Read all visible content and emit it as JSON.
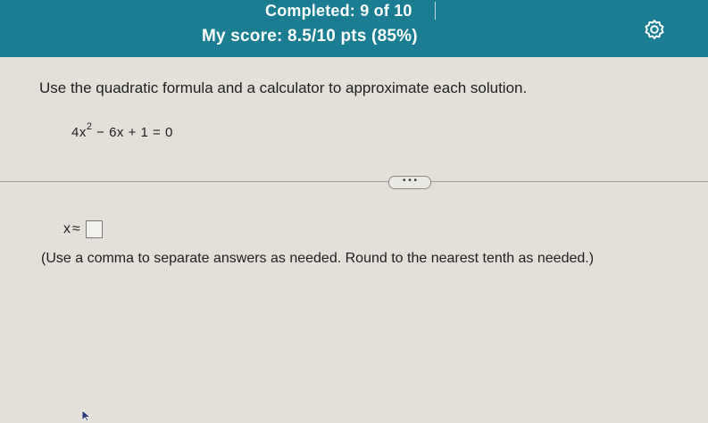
{
  "header": {
    "progress": "Completed: 9 of 10",
    "score": "My score: 8.5/10 pts (85%)",
    "settings_icon": "gear-icon"
  },
  "question": {
    "instructions": "Use the quadratic formula and a calculator to approximate each solution.",
    "equation": {
      "lead": "4x",
      "exponent": "2",
      "rest": "− 6x + 1 = 0"
    },
    "expand_label": "• • •",
    "answer": {
      "variable": "x",
      "symbol": "≈",
      "value": ""
    },
    "hint": "(Use a comma to separate answers as needed. Round to the nearest tenth as needed.)"
  },
  "colors": {
    "header_bg": "#1a7d92",
    "page_bg": "#e3e0da"
  }
}
